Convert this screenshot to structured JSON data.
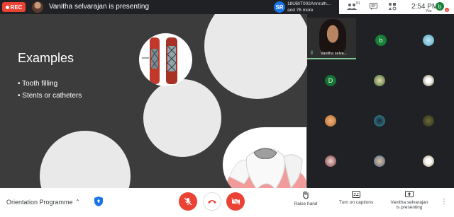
{
  "topbar": {
    "rec_label": "REC",
    "presenter_text": "Vanitha selvarajan is presenting",
    "participant_initials": "SR",
    "participant_line1": "18UBIT002Annruth...",
    "participant_line2": "and 76 more",
    "people_count": "91",
    "time": "2:54 PM",
    "you_initial": "b",
    "you_label": "You",
    "you_badge": "5"
  },
  "slide": {
    "title": "Examples",
    "bullets": [
      "Tooth filling",
      "Stents or catheters"
    ]
  },
  "grid": {
    "self_name": "Vanitha selva...",
    "tiles": [
      {
        "initial": "b",
        "color": "#188038"
      },
      {
        "initial": "D",
        "color": "#137333"
      }
    ]
  },
  "bottombar": {
    "meeting_name": "Orientation Programme",
    "raise_hand_label": "Raise hand",
    "captions_label": "Turn on captions",
    "presenting_line1": "Vanitha selvarajan",
    "presenting_line2": "is presenting"
  },
  "colors": {
    "record_red": "#ea4335",
    "accent_blue": "#1a73e8",
    "speaking_green": "#81c995"
  }
}
